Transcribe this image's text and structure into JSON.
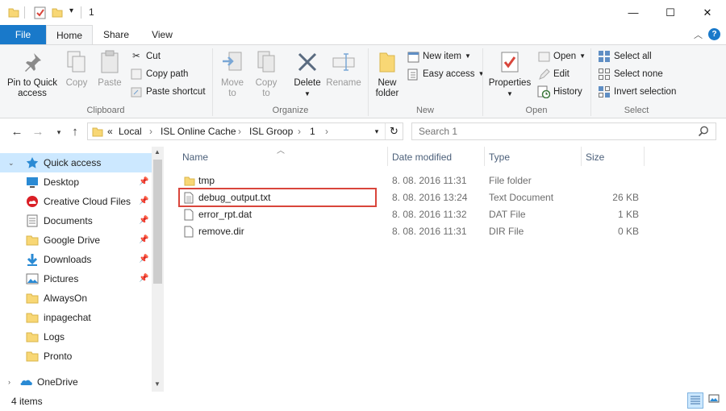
{
  "window": {
    "title": "1",
    "controls": {
      "minimize": "—",
      "maximize": "☐",
      "close": "✕"
    }
  },
  "tabs": {
    "file": "File",
    "home": "Home",
    "share": "Share",
    "view": "View"
  },
  "ribbon": {
    "clipboard": {
      "label": "Clipboard",
      "pin_line1": "Pin to Quick",
      "pin_line2": "access",
      "copy": "Copy",
      "paste": "Paste",
      "cut": "Cut",
      "copy_path": "Copy path",
      "paste_shortcut": "Paste shortcut"
    },
    "organize": {
      "label": "Organize",
      "move_line1": "Move",
      "move_line2": "to",
      "copy_line1": "Copy",
      "copy_line2": "to",
      "delete": "Delete",
      "rename": "Rename"
    },
    "new": {
      "label": "New",
      "folder_line1": "New",
      "folder_line2": "folder",
      "new_item": "New item",
      "easy_access": "Easy access"
    },
    "open": {
      "label": "Open",
      "properties": "Properties",
      "open": "Open",
      "edit": "Edit",
      "history": "History"
    },
    "select": {
      "label": "Select",
      "select_all": "Select all",
      "select_none": "Select none",
      "invert_selection": "Invert selection"
    }
  },
  "address": {
    "overflow": "«",
    "crumbs": [
      "Local",
      "ISL Online Cache",
      "ISL Groop",
      "1"
    ],
    "separator": "›"
  },
  "search": {
    "placeholder": "Search 1"
  },
  "sidebar": {
    "items": [
      {
        "label": "Quick access",
        "icon": "star-icon",
        "pinned": false
      },
      {
        "label": "Desktop",
        "icon": "desktop-icon",
        "pinned": true
      },
      {
        "label": "Creative Cloud Files",
        "icon": "creative-cloud-icon",
        "pinned": true
      },
      {
        "label": "Documents",
        "icon": "documents-icon",
        "pinned": true
      },
      {
        "label": "Google Drive",
        "icon": "folder-icon",
        "pinned": true
      },
      {
        "label": "Downloads",
        "icon": "download-icon",
        "pinned": true
      },
      {
        "label": "Pictures",
        "icon": "pictures-icon",
        "pinned": true
      },
      {
        "label": "AlwaysOn",
        "icon": "folder-icon",
        "pinned": false
      },
      {
        "label": "inpagechat",
        "icon": "folder-icon",
        "pinned": false
      },
      {
        "label": "Logs",
        "icon": "folder-icon",
        "pinned": false
      },
      {
        "label": "Pronto",
        "icon": "folder-icon",
        "pinned": false
      },
      {
        "label": "OneDrive",
        "icon": "onedrive-icon",
        "pinned": false
      }
    ]
  },
  "columns": {
    "name": "Name",
    "date": "Date modified",
    "type": "Type",
    "size": "Size"
  },
  "files": [
    {
      "name": "tmp",
      "date": "8. 08. 2016 11:31",
      "type": "File folder",
      "size": "",
      "icon": "folder-icon"
    },
    {
      "name": "debug_output.txt",
      "date": "8. 08. 2016 13:24",
      "type": "Text Document",
      "size": "26 KB",
      "icon": "text-file-icon"
    },
    {
      "name": "error_rpt.dat",
      "date": "8. 08. 2016 11:32",
      "type": "DAT File",
      "size": "1 KB",
      "icon": "file-icon"
    },
    {
      "name": "remove.dir",
      "date": "8. 08. 2016 11:31",
      "type": "DIR File",
      "size": "0 KB",
      "icon": "file-icon"
    }
  ],
  "status": {
    "count": "4 items"
  },
  "colors": {
    "accent": "#1979ca",
    "highlight": "#d9453b",
    "folder": "#f8d775",
    "selection": "#cce8ff"
  }
}
